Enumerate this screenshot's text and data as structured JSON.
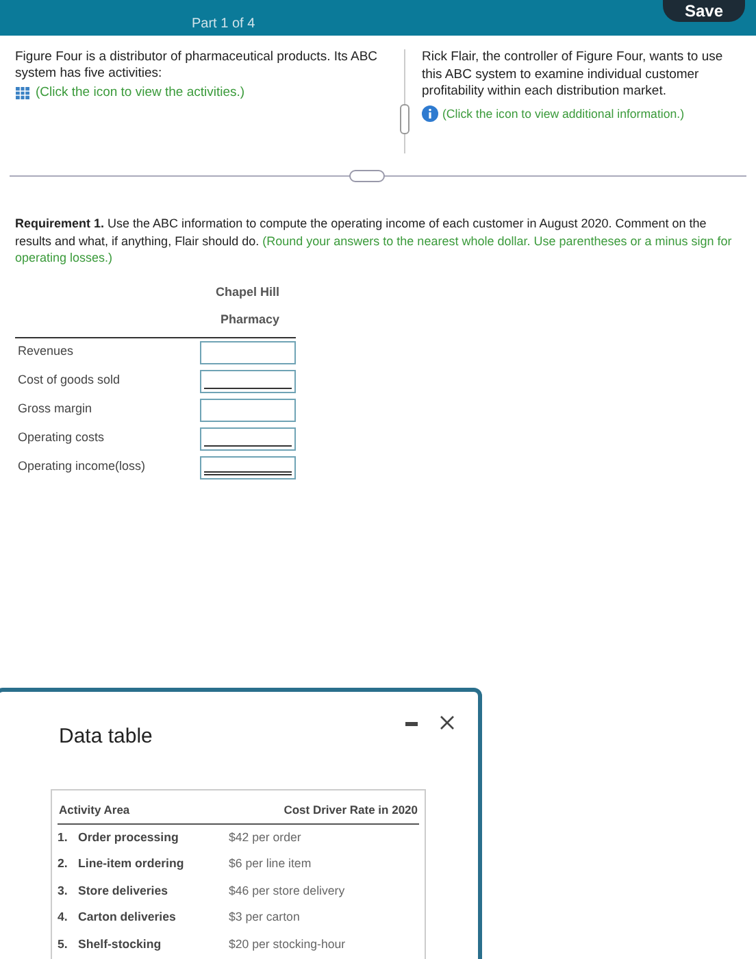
{
  "header": {
    "part": "Part 1 of 4",
    "save": "Save"
  },
  "left_pane": {
    "text": "Figure Four is a distributor of pharmaceutical products. Its ABC system has five activities:",
    "link": "(Click the icon to view the activities.)"
  },
  "right_pane": {
    "text": "Rick Flair, the controller of Figure Four, wants to use this ABC system to examine individual customer profitability within each distribution market.",
    "link": "(Click the icon to view additional information.)"
  },
  "requirement": {
    "text": "**Requirement 1.** Use the ABC information to compute the operating income of each customer in August 2020. Comment on the results and what, if anything, Flair should do.",
    "hint": "(Round your answers to the nearest whole dollar. Use parentheses or a minus sign for operating losses.)"
  },
  "table": {
    "header": [
      "Chapel Hill",
      "Pharmacy"
    ],
    "rows": [
      {
        "label": "Revenues",
        "kind": "plain"
      },
      {
        "label": "Cost of goods sold",
        "kind": "single"
      },
      {
        "label": "Gross margin",
        "kind": "plain"
      },
      {
        "label": "Operating costs",
        "kind": "single"
      },
      {
        "label": "Operating income(loss)",
        "kind": "double"
      }
    ]
  },
  "dialog": {
    "title": "Data table",
    "columns": [
      "Activity Area",
      "Cost Driver Rate in 2020"
    ],
    "rows": [
      {
        "number": "1.",
        "activity": "Order processing",
        "rate": "$42 per order"
      },
      {
        "number": "2.",
        "activity": "Line-item ordering",
        "rate": "$6 per line item"
      },
      {
        "number": "3.",
        "activity": "Store deliveries",
        "rate": "$46 per store delivery"
      },
      {
        "number": "4.",
        "activity": "Carton deliveries",
        "rate": "$3 per carton"
      },
      {
        "number": "5.",
        "activity": "Shelf-stocking",
        "rate": "$20 per stocking-hour"
      }
    ]
  }
}
